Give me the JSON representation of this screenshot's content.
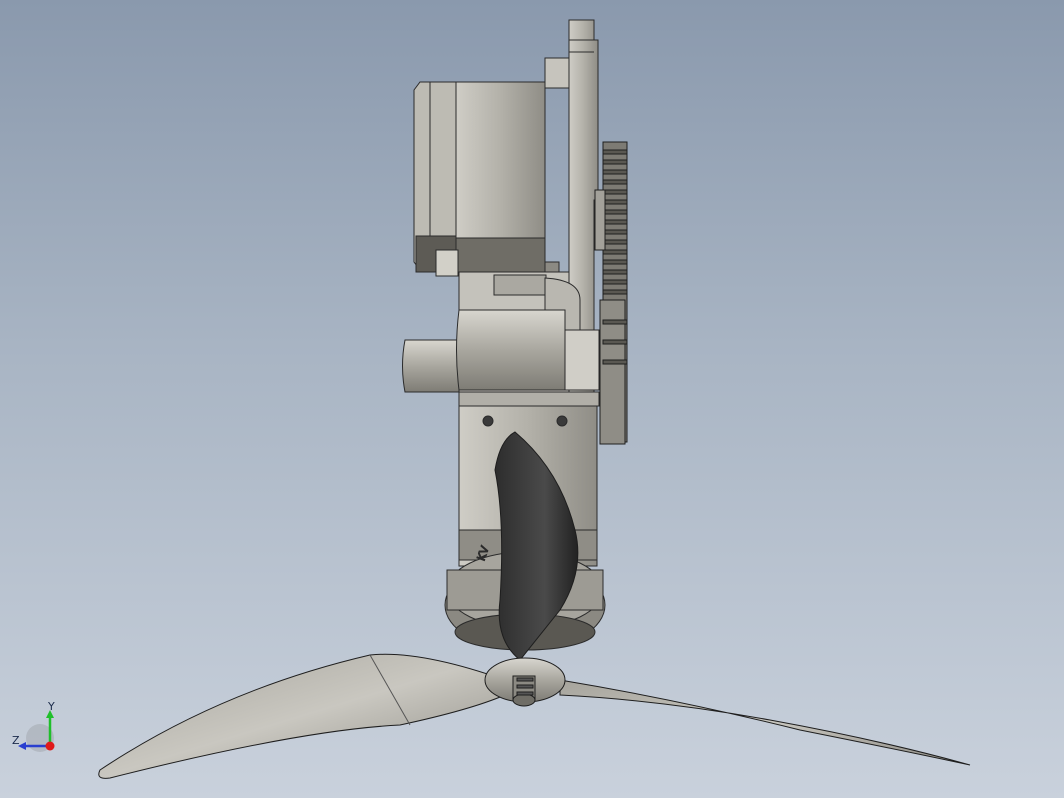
{
  "viewport": {
    "background_top": "#8a99ad",
    "background_bottom": "#c9d1dc",
    "model_color": "#b4b2aa",
    "propeller_blade_color": "#3a3a3a"
  },
  "model": {
    "motor_label": "KV"
  },
  "axis_triad": {
    "y_label": "Y",
    "z_label": "Z",
    "y_color": "#1fbf2a",
    "z_color": "#2a3fd0",
    "x_color": "#e01a1a"
  }
}
